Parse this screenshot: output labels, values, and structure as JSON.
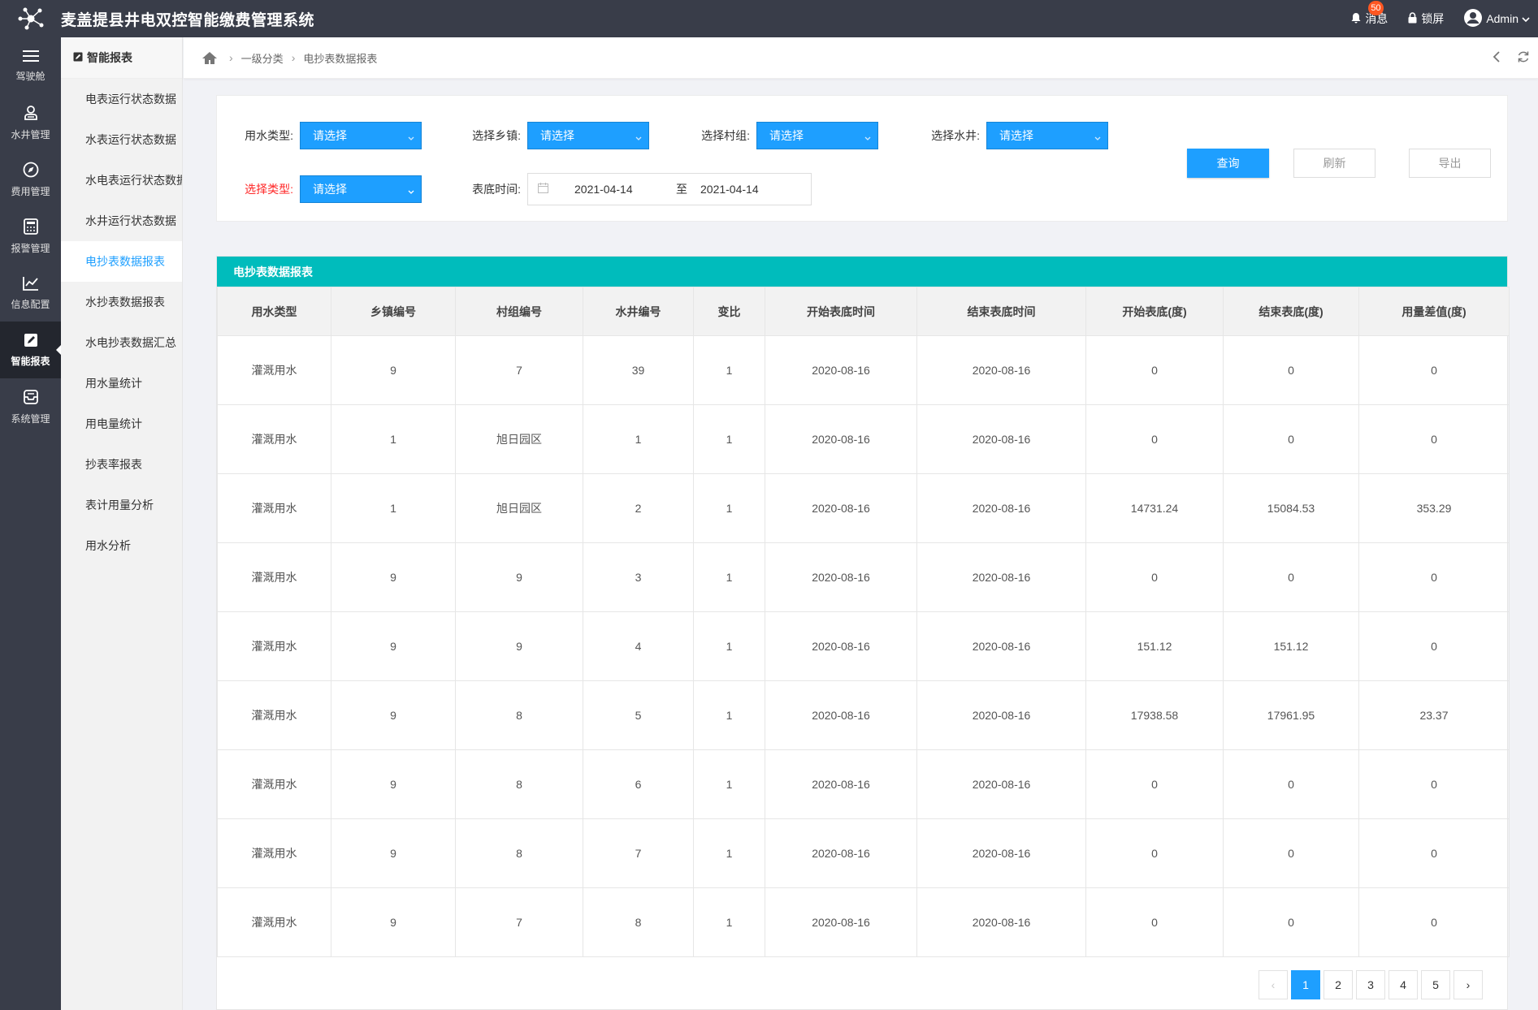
{
  "header": {
    "title": "麦盖提县井电双控智能缴费管理系统",
    "messages_label": "消息",
    "messages_count": "50",
    "lock_label": "锁屏",
    "user_label": "Admin"
  },
  "rail": [
    {
      "label": "驾驶舱",
      "icon": "menu-icon"
    },
    {
      "label": "水井管理",
      "icon": "well-icon"
    },
    {
      "label": "费用管理",
      "icon": "compass-icon"
    },
    {
      "label": "报警管理",
      "icon": "calculator-icon"
    },
    {
      "label": "信息配置",
      "icon": "chart-line-icon"
    },
    {
      "label": "智能报表",
      "icon": "edit-icon"
    },
    {
      "label": "系统管理",
      "icon": "inbox-icon"
    }
  ],
  "subnav": {
    "title": "智能报表",
    "items": [
      "电表运行状态数据",
      "水表运行状态数据",
      "水电表运行状态数据",
      "水井运行状态数据",
      "电抄表数据报表",
      "水抄表数据报表",
      "水电抄表数据汇总",
      "用水量统计",
      "用电量统计",
      "抄表率报表",
      "表计用量分析",
      "用水分析"
    ],
    "active_index": 4
  },
  "breadcrumb": [
    "一级分类",
    "电抄表数据报表"
  ],
  "filters": {
    "water_type_label": "用水类型:",
    "town_label": "选择乡镇:",
    "village_label": "选择村组:",
    "well_label": "选择水井:",
    "select_type_label": "选择类型:",
    "date_label": "表底时间:",
    "placeholder": "请选择",
    "date_start": "2021-04-14",
    "date_to": "至",
    "date_end": "2021-04-14"
  },
  "buttons": {
    "query": "查询",
    "refresh": "刷新",
    "export": "导出"
  },
  "table": {
    "title": "电抄表数据报表",
    "columns": [
      "用水类型",
      "乡镇编号",
      "村组编号",
      "水井编号",
      "变比",
      "开始表底时间",
      "结束表底时间",
      "开始表底(度)",
      "结束表底(度)",
      "用量差值(度)"
    ],
    "rows": [
      [
        "灌溉用水",
        "9",
        "7",
        "39",
        "1",
        "2020-08-16",
        "2020-08-16",
        "0",
        "0",
        "0"
      ],
      [
        "灌溉用水",
        "1",
        "旭日园区",
        "1",
        "1",
        "2020-08-16",
        "2020-08-16",
        "0",
        "0",
        "0"
      ],
      [
        "灌溉用水",
        "1",
        "旭日园区",
        "2",
        "1",
        "2020-08-16",
        "2020-08-16",
        "14731.24",
        "15084.53",
        "353.29"
      ],
      [
        "灌溉用水",
        "9",
        "9",
        "3",
        "1",
        "2020-08-16",
        "2020-08-16",
        "0",
        "0",
        "0"
      ],
      [
        "灌溉用水",
        "9",
        "9",
        "4",
        "1",
        "2020-08-16",
        "2020-08-16",
        "151.12",
        "151.12",
        "0"
      ],
      [
        "灌溉用水",
        "9",
        "8",
        "5",
        "1",
        "2020-08-16",
        "2020-08-16",
        "17938.58",
        "17961.95",
        "23.37"
      ],
      [
        "灌溉用水",
        "9",
        "8",
        "6",
        "1",
        "2020-08-16",
        "2020-08-16",
        "0",
        "0",
        "0"
      ],
      [
        "灌溉用水",
        "9",
        "8",
        "7",
        "1",
        "2020-08-16",
        "2020-08-16",
        "0",
        "0",
        "0"
      ],
      [
        "灌溉用水",
        "9",
        "7",
        "8",
        "1",
        "2020-08-16",
        "2020-08-16",
        "0",
        "0",
        "0"
      ]
    ]
  },
  "pagination": {
    "prev": "‹",
    "pages": [
      "1",
      "2",
      "3",
      "4",
      "5"
    ],
    "current": "1",
    "next": "›"
  },
  "colors": {
    "primary": "#1e9fff",
    "teal": "#00bcbc",
    "dark": "#393d49",
    "badge": "#ff5722"
  }
}
